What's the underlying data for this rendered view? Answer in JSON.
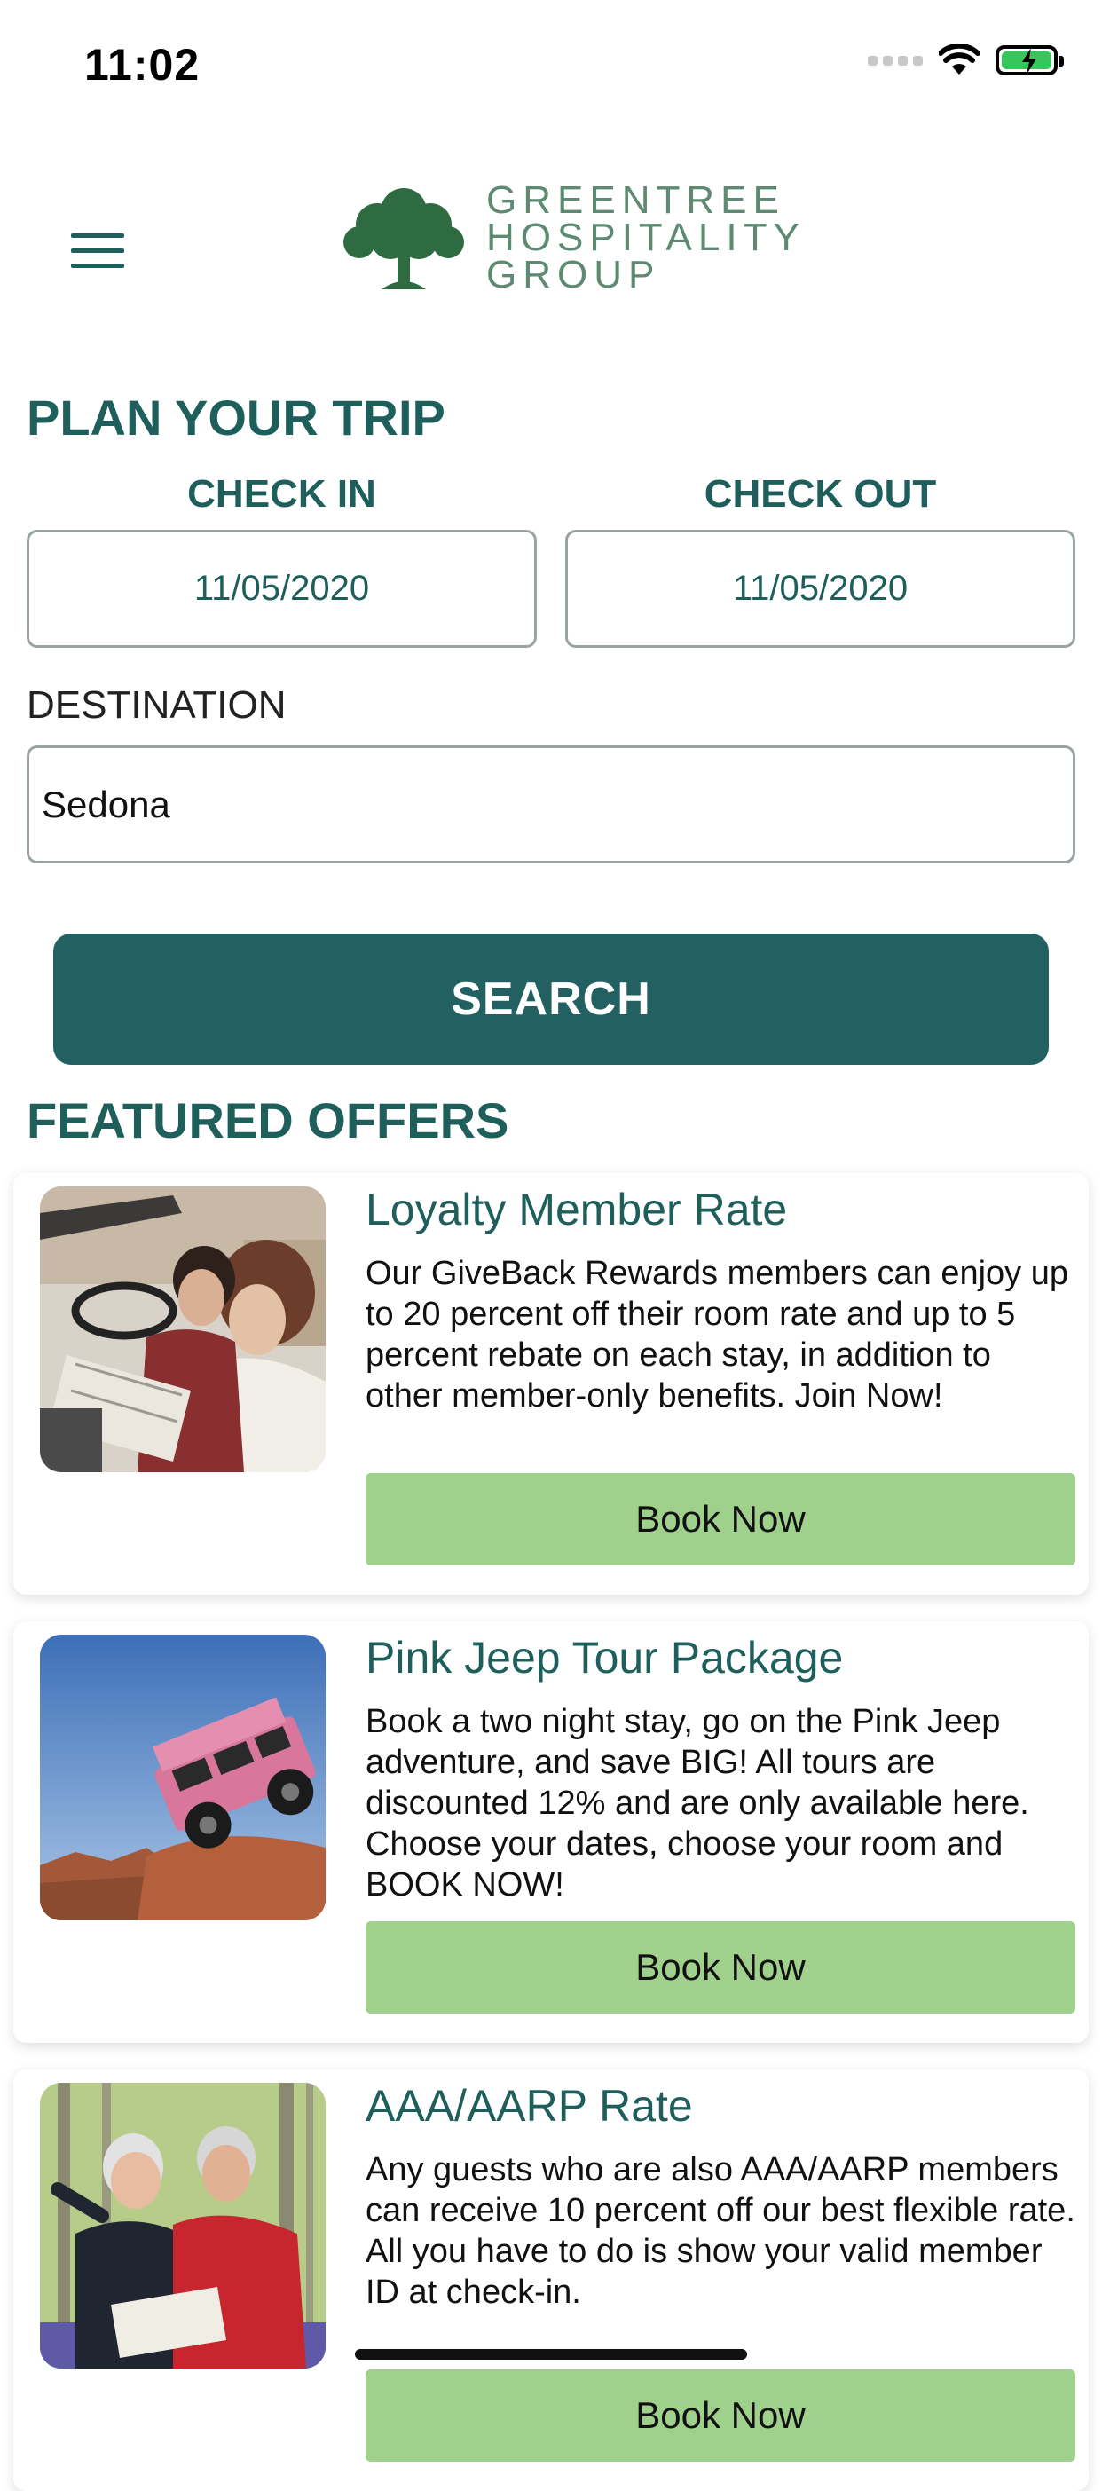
{
  "status_bar": {
    "time": "11:02"
  },
  "brand": {
    "line1": "GREENTREE",
    "line2": "HOSPITALITY",
    "line3": "GROUP"
  },
  "plan": {
    "heading": "PLAN YOUR TRIP",
    "check_in_label": "CHECK IN",
    "check_in_value": "11/05/2020",
    "check_out_label": "CHECK OUT",
    "check_out_value": "11/05/2020",
    "destination_label": "DESTINATION",
    "destination_value": "Sedona",
    "search_label": "SEARCH"
  },
  "offers": {
    "heading": "FEATURED OFFERS",
    "items": [
      {
        "title": "Loyalty Member Rate",
        "description": "Our GiveBack Rewards members can enjoy up to 20 percent off their room rate and up to 5 percent rebate on each stay, in addition to other member-only benefits. Join Now!",
        "button": "Book Now"
      },
      {
        "title": "Pink Jeep Tour Package",
        "description": "Book a two night stay, go on the Pink Jeep adventure, and save BIG! All tours are discounted 12% and are only available here. Choose your dates, choose your room and BOOK NOW!",
        "button": "Book Now"
      },
      {
        "title": "AAA/AARP Rate",
        "description": "Any guests who are also AAA/AARP members can receive 10 percent off our best flexible rate. All you have to do is show your valid member ID at check-in.",
        "button": "Book Now"
      }
    ]
  },
  "colors": {
    "primary": "#236062",
    "text_teal": "#1f5f5b",
    "book_button": "#9fd08c",
    "logo_green": "#2f6b40"
  }
}
